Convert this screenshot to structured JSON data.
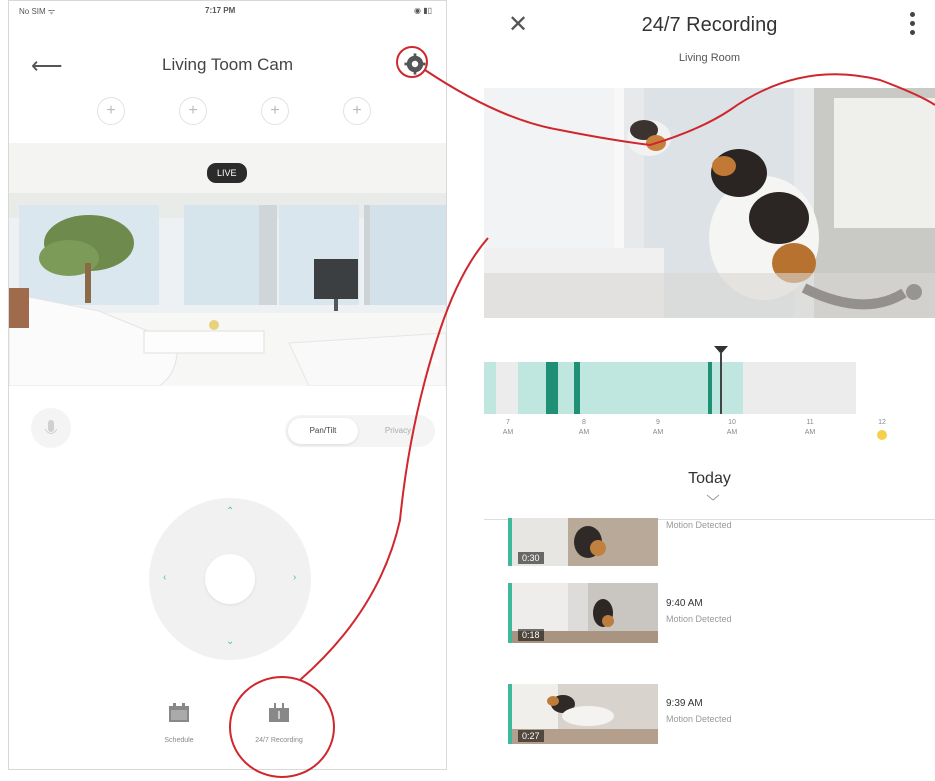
{
  "left_phone": {
    "status": {
      "carrier": "No SIM ᯤ",
      "time": "7:17 PM",
      "battery": "◉ ▮▯"
    },
    "header": {
      "back_icon": "arrow-left-icon",
      "title": "Living Toom Cam",
      "settings_icon": "gear-icon"
    },
    "presets": [
      "+",
      "+",
      "+",
      "+"
    ],
    "live_badge": "LIVE",
    "controls": {
      "mode_options": [
        "Pan/Tilt",
        "Privacy"
      ],
      "selected_mode": "Pan/Tilt"
    },
    "tabs": [
      {
        "label": "Schedule",
        "icon": "calendar-icon"
      },
      {
        "label": "24/7 Recording",
        "icon": "recording-icon"
      }
    ]
  },
  "right_phone": {
    "header": {
      "close_icon": "close-icon",
      "title": "24/7 Recording",
      "subtitle": "Living Room",
      "menu_icon": "more-vertical-icon"
    },
    "timeline": {
      "ticks": [
        {
          "hour": "7",
          "period": "AM"
        },
        {
          "hour": "8",
          "period": "AM"
        },
        {
          "hour": "9",
          "period": "AM"
        },
        {
          "hour": "10",
          "period": "AM"
        },
        {
          "hour": "11",
          "period": "AM"
        },
        {
          "hour": "12",
          "period": ""
        }
      ]
    },
    "day_label": "Today",
    "events": [
      {
        "time": "",
        "type": "Motion Detected",
        "duration": "0:30"
      },
      {
        "time": "9:40 AM",
        "type": "Motion Detected",
        "duration": "0:18"
      },
      {
        "time": "9:39 AM",
        "type": "Motion Detected",
        "duration": "0:27"
      }
    ]
  },
  "colors": {
    "accent": "#3fb99b",
    "callout": "#d0262d",
    "timeline_fill": "#bfe6df"
  }
}
